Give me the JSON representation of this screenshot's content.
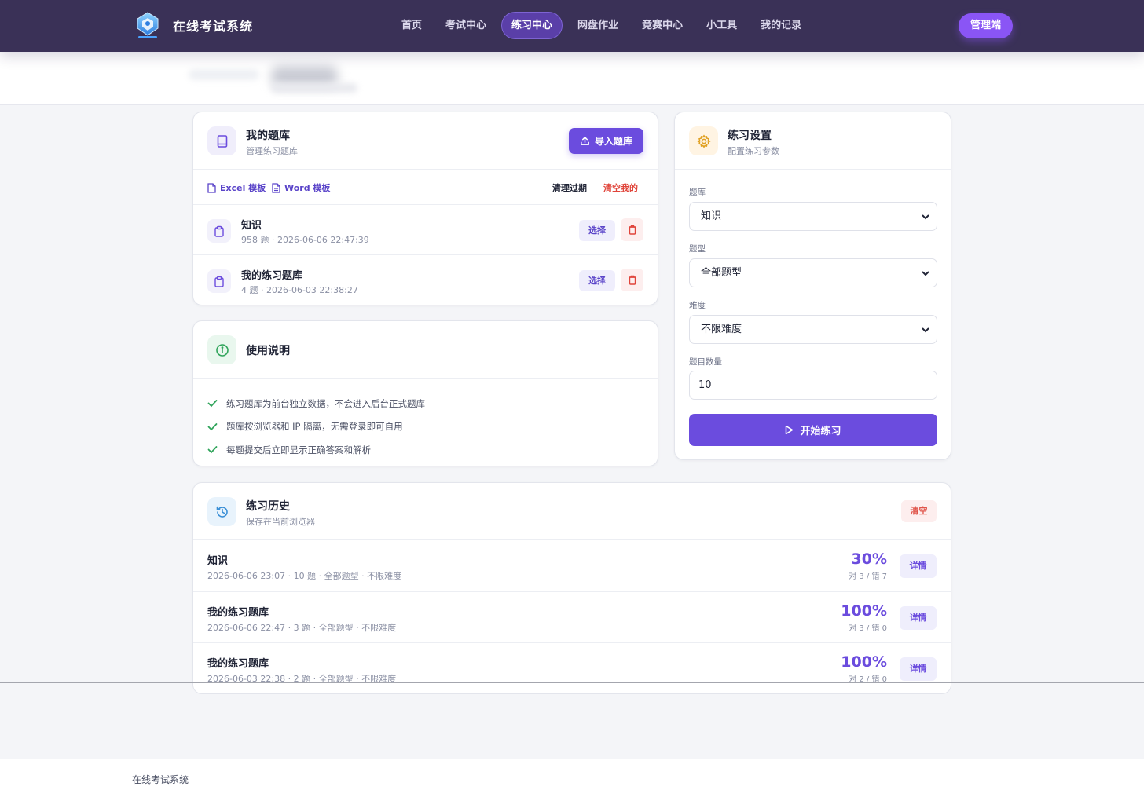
{
  "brand": {
    "name": "在线考试系统",
    "logo": "crystal-logo-icon",
    "accent": "#6b4cde"
  },
  "nav": {
    "items": [
      {
        "label": "首页"
      },
      {
        "label": "考试中心"
      },
      {
        "label": "练习中心"
      },
      {
        "label": "网盘作业"
      },
      {
        "label": "竞赛中心"
      },
      {
        "label": "小工具"
      },
      {
        "label": "我的记录"
      }
    ],
    "active": "练习中心",
    "admin_label": "管理端"
  },
  "bank": {
    "title": "我的题库",
    "subtitle": "管理练习题库",
    "import_label": "导入题库",
    "excel_template": "Excel 模板",
    "word_template": "Word 模板",
    "clean_expired": "清理过期",
    "clear_mine": "清空我的",
    "rows": [
      {
        "name": "知识",
        "meta": "958 题 · 2026-06-06 22:47:39",
        "select_label": "选择"
      },
      {
        "name": "我的练习题库",
        "meta": "4 题 · 2026-06-03 22:38:27",
        "select_label": "选择"
      }
    ]
  },
  "guide": {
    "title": "使用说明",
    "items": [
      "练习题库为前台独立数据，不会进入后台正式题库",
      "题库按浏览器和 IP 隔离，无需登录即可自用",
      "每题提交后立即显示正确答案和解析"
    ]
  },
  "settings": {
    "title": "练习设置",
    "subtitle": "配置练习参数",
    "bank_label": "题库",
    "bank_value": "知识",
    "type_label": "题型",
    "type_value": "全部题型",
    "difficulty_label": "难度",
    "difficulty_value": "不限难度",
    "count_label": "题目数量",
    "count_value": "10",
    "start_label": "开始练习"
  },
  "history": {
    "title": "练习历史",
    "subtitle": "保存在当前浏览器",
    "clear_label": "清空",
    "rows": [
      {
        "name": "知识",
        "meta": "2026-06-06 23:07 · 10 题 · 全部题型 · 不限难度",
        "pct": "30%",
        "score": "对 3 / 错 7",
        "detail_label": "详情"
      },
      {
        "name": "我的练习题库",
        "meta": "2026-06-06 22:47 · 3 题 · 全部题型 · 不限难度",
        "pct": "100%",
        "score": "对 3 / 错 0",
        "detail_label": "详情"
      },
      {
        "name": "我的练习题库",
        "meta": "2026-06-03 22:38 · 2 题 · 全部题型 · 不限难度",
        "pct": "100%",
        "score": "对 2 / 错 0",
        "detail_label": "详情"
      }
    ]
  },
  "footer": {
    "text": "在线考试系统"
  }
}
